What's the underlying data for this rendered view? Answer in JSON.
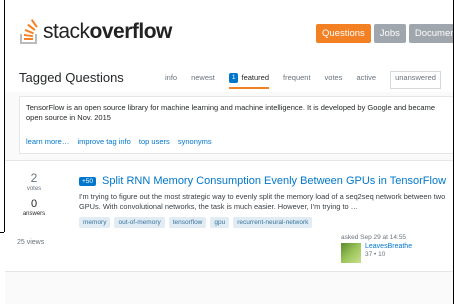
{
  "header": {
    "logo_plain": "stack",
    "logo_bold": "overflow",
    "nav": [
      "Questions",
      "Jobs",
      "Documentatio"
    ]
  },
  "subhead": {
    "title": "Tagged Questions",
    "tabs": [
      "info",
      "newest",
      "featured",
      "frequent",
      "votes",
      "active",
      "unanswered"
    ],
    "featured_count": "1"
  },
  "info": {
    "text": "TensorFlow is an open source library for machine learning and machine intelligence. It is developed by Google and became open source in Nov. 2015",
    "links": [
      "learn more…",
      "improve tag info",
      "top users",
      "synonyms"
    ]
  },
  "question": {
    "votes": "2",
    "votes_label": "votes",
    "answers": "0",
    "answers_label": "answers",
    "views": "25 views",
    "bounty": "+50",
    "title": "Split RNN Memory Consumption Evenly Between GPUs in TensorFlow",
    "excerpt": "I'm trying to figure out the most strategic way to evenly split the memory load of a seq2seq network between two GPUs. With convolutional networks, the task is much easier. However, I'm trying to …",
    "tags": [
      "memory",
      "out-of-memory",
      "tensorflow",
      "gpu",
      "recurrent-neural-network"
    ],
    "asked": "asked Sep 29 at 14:55",
    "owner_name": "LeavesBreathe",
    "owner_rep": "37 • 10"
  },
  "colors": {
    "accent": "#f48024",
    "link": "#0077cc",
    "tag_bg": "#e1ecf4"
  }
}
